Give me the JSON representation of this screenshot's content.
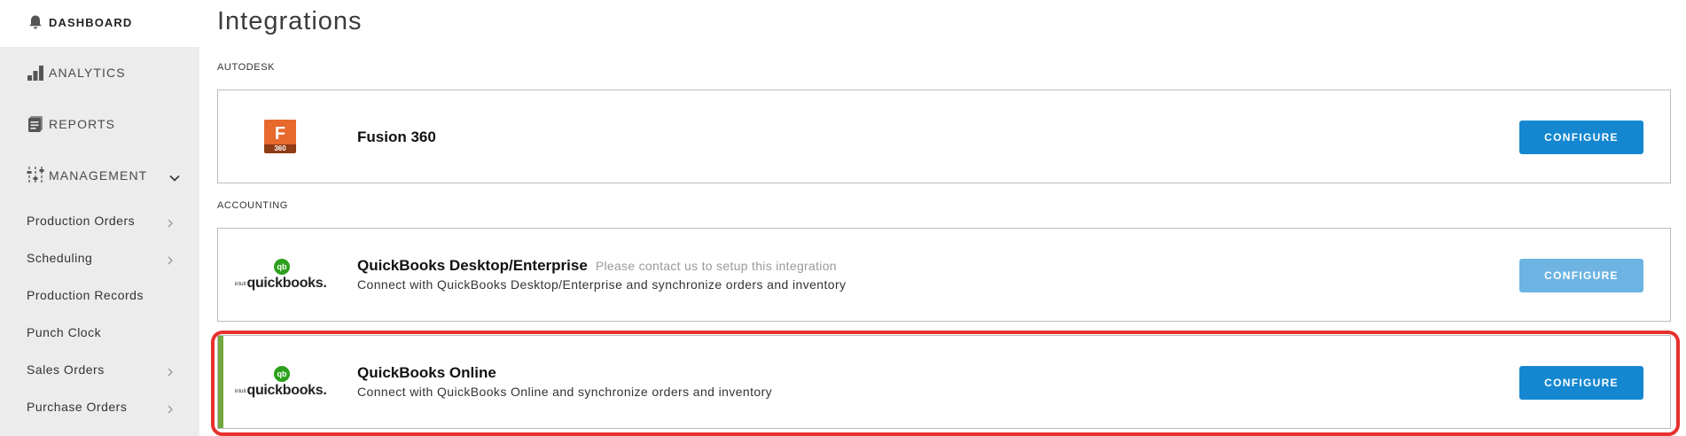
{
  "sidebar": {
    "nav": [
      {
        "label": "DASHBOARD",
        "icon": "bell-icon",
        "active": true
      },
      {
        "label": "ANALYTICS",
        "icon": "bar-chart-icon"
      },
      {
        "label": "REPORTS",
        "icon": "document-stack-icon"
      },
      {
        "label": "MANAGEMENT",
        "icon": "sliders-icon",
        "expanded": true
      }
    ],
    "sub_items": [
      {
        "label": "Production Orders",
        "has_chevron": true
      },
      {
        "label": "Scheduling",
        "has_chevron": true
      },
      {
        "label": "Production Records",
        "has_chevron": false
      },
      {
        "label": "Punch Clock",
        "has_chevron": false
      },
      {
        "label": "Sales Orders",
        "has_chevron": true
      },
      {
        "label": "Purchase Orders",
        "has_chevron": true
      }
    ]
  },
  "main": {
    "title": "Integrations",
    "sections": [
      {
        "label": "AUTODESK",
        "cards": [
          {
            "logo": "fusion-360-logo",
            "logo_letter": "F",
            "logo_badge": "360",
            "title": "Fusion 360",
            "note": "",
            "description": "",
            "button": "CONFIGURE",
            "button_disabled": false
          }
        ]
      },
      {
        "label": "ACCOUNTING",
        "cards": [
          {
            "logo": "quickbooks-logo",
            "logo_text": "quickbooks.",
            "logo_small": "intuit",
            "logo_mark": "qb",
            "title": "QuickBooks Desktop/Enterprise",
            "note": "Please contact us to setup this integration",
            "description": "Connect with QuickBooks Desktop/Enterprise and synchronize orders and inventory",
            "button": "CONFIGURE",
            "button_disabled": true
          },
          {
            "logo": "quickbooks-logo",
            "logo_text": "quickbooks.",
            "logo_small": "intuit",
            "logo_mark": "qb",
            "title": "QuickBooks Online",
            "note": "",
            "description": "Connect with QuickBooks Online and synchronize orders and inventory",
            "button": "CONFIGURE",
            "button_disabled": false,
            "connected": true,
            "highlighted": true
          }
        ]
      }
    ]
  },
  "colors": {
    "primary_button": "#1487d0",
    "disabled_button": "#6db4e3",
    "connected_bar": "#72a83e",
    "highlight_outline": "#e8302d",
    "fusion_orange": "#e8692c",
    "quickbooks_green": "#2ca01c"
  }
}
